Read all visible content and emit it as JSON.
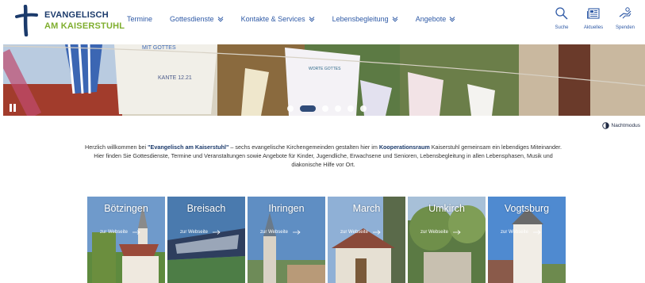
{
  "brand": {
    "line1": "EVANGELISCH",
    "line2": "AM KAISERSTUHL",
    "colors": {
      "navy": "#1b3a6b",
      "green": "#7fae2e",
      "link": "#2f5aa6"
    }
  },
  "nav": {
    "items": [
      {
        "label": "Termine",
        "has_dropdown": false
      },
      {
        "label": "Gottesdienste",
        "has_dropdown": true
      },
      {
        "label": "Kontakte & Services",
        "has_dropdown": true
      },
      {
        "label": "Lebensbegleitung",
        "has_dropdown": true
      },
      {
        "label": "Angebote",
        "has_dropdown": true
      }
    ]
  },
  "tools": [
    {
      "label": "Suche",
      "icon": "search-icon"
    },
    {
      "label": "Aktuelles",
      "icon": "newspaper-icon"
    },
    {
      "label": "Spenden",
      "icon": "donate-hand-icon"
    }
  ],
  "hero": {
    "flag_texts": [
      "MIT GOTTES",
      "KANTE 12.21",
      "WORTE GOTTES"
    ],
    "slides_count": 6,
    "active_slide": 1
  },
  "nightmode": {
    "label": "Nachtmodus",
    "icon": "half-moon-icon"
  },
  "intro": {
    "p1_prefix": "Herzlich willkommen bei ",
    "p1_strong1": "\"Evangelisch am Kaiserstuhl\"",
    "p1_mid": " – sechs evangelische Kirchengemeinden gestalten hier im ",
    "p1_strong2": "Kooperationsraum",
    "p1_suffix": " Kaiserstuhl gemeinsam ein lebendiges Miteinander.",
    "p2": "Hier finden Sie Gottesdienste, Termine und Veranstaltungen sowie Angebote für Kinder, Jugendliche, Erwachsene und Senioren, Lebensbegleitung in allen Lebensphasen, Musik und diakonische Hilfe vor Ort."
  },
  "parishes": [
    {
      "name": "Bötzingen",
      "link": "zur Webseite"
    },
    {
      "name": "Breisach",
      "link": "zur Webseite"
    },
    {
      "name": "Ihringen",
      "link": "zur Webseite"
    },
    {
      "name": "March",
      "link": "zur Webseite"
    },
    {
      "name": "Umkirch",
      "link": "zur Webseite"
    },
    {
      "name": "Vogtsburg",
      "link": "zur Webseite"
    }
  ]
}
